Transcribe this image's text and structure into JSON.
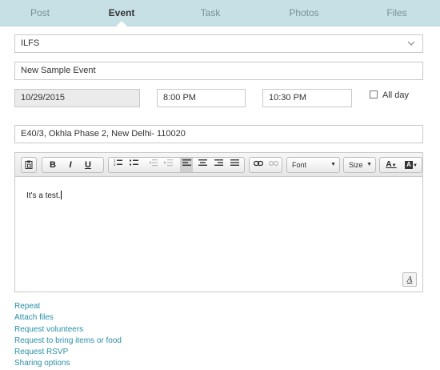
{
  "tabs": [
    "Post",
    "Event",
    "Task",
    "Photos",
    "Files"
  ],
  "group_select": {
    "value": "ILFS",
    "icon": "chevron-down-icon"
  },
  "event_title": {
    "value": "New Sample Event"
  },
  "start_date": {
    "value": "10/29/2015"
  },
  "start_time": {
    "value": "8:00 PM"
  },
  "end_time": {
    "value": "10:30 PM"
  },
  "all_day": {
    "label": "All day",
    "checked": false
  },
  "location": {
    "value": "E40/3, Okhla Phase 2, New Delhi- 110020"
  },
  "toolbar": {
    "bold": "B",
    "italic": "I",
    "underline": "U",
    "font_label": "Font",
    "size_label": "Size",
    "text_color": "A",
    "bg_color": "A"
  },
  "editor": {
    "text": "It's a test."
  },
  "links": [
    "Repeat",
    "Attach files",
    "Request volunteers",
    "Request to bring items or food",
    "Request RSVP",
    "Sharing options"
  ],
  "colors": {
    "tab_bar": "#c6e0e6",
    "link": "#2a8fa8"
  }
}
